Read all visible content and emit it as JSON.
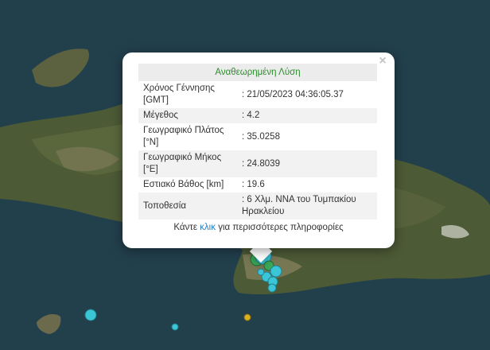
{
  "popup": {
    "title": "Αναθεωρημένη Λύση",
    "close_symbol": "×",
    "rows": [
      {
        "label": "Χρόνος Γέννησης [GMT]",
        "value": ": 21/05/2023 04:36:05.37"
      },
      {
        "label": "Μέγεθος",
        "value": ": 4.2"
      },
      {
        "label": "Γεωγραφικό Πλάτος [°N]",
        "value": ": 35.0258"
      },
      {
        "label": "Γεωγραφικό Μήκος [°E]",
        "value": ": 24.8039"
      },
      {
        "label": "Εστιακό Βάθος [km]",
        "value": ": 19.6"
      },
      {
        "label": "Τοποθεσία",
        "value": ": 6 Χλμ. ΝΝΑ του Τυμπακίου Ηρακλείου"
      }
    ],
    "footer_prefix": "Κάντε",
    "footer_link": "κλικ",
    "footer_suffix": "για περισσότερες πληροφορίες"
  },
  "colors": {
    "title_green": "#2e8b2e",
    "link_blue": "#2a7fc1",
    "marker_cyan": "#3bc6d8",
    "marker_green": "#3aa85a",
    "marker_yellow": "#d8b020"
  }
}
